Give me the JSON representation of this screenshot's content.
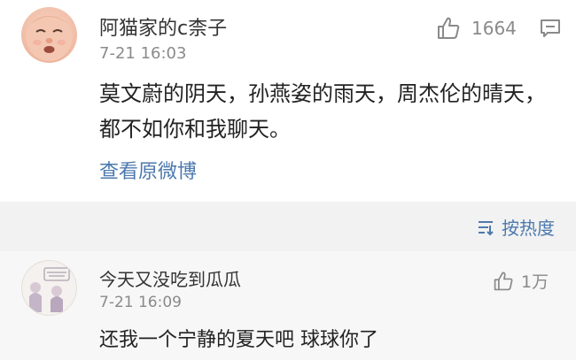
{
  "comment1": {
    "username": "阿猫家的c柰子",
    "time": "7-21 16:03",
    "like_count": "1664",
    "content": "莫文蔚的阴天，孙燕姿的雨天，周杰伦的晴天，都不如你和我聊天。",
    "view_original": "查看原微博"
  },
  "sort": {
    "label": "按热度"
  },
  "comment2": {
    "username": "今天又没吃到瓜瓜",
    "time": "7-21 16:09",
    "like_count": "1万",
    "content": "还我一个宁静的夏天吧 球球你了"
  },
  "colors": {
    "link": "#4d79ad",
    "meta": "#8a8a8a",
    "text": "#222222",
    "section_bg": "#f2f2f2"
  },
  "icons": [
    "thumbs-up-icon",
    "comment-icon",
    "sort-icon"
  ]
}
